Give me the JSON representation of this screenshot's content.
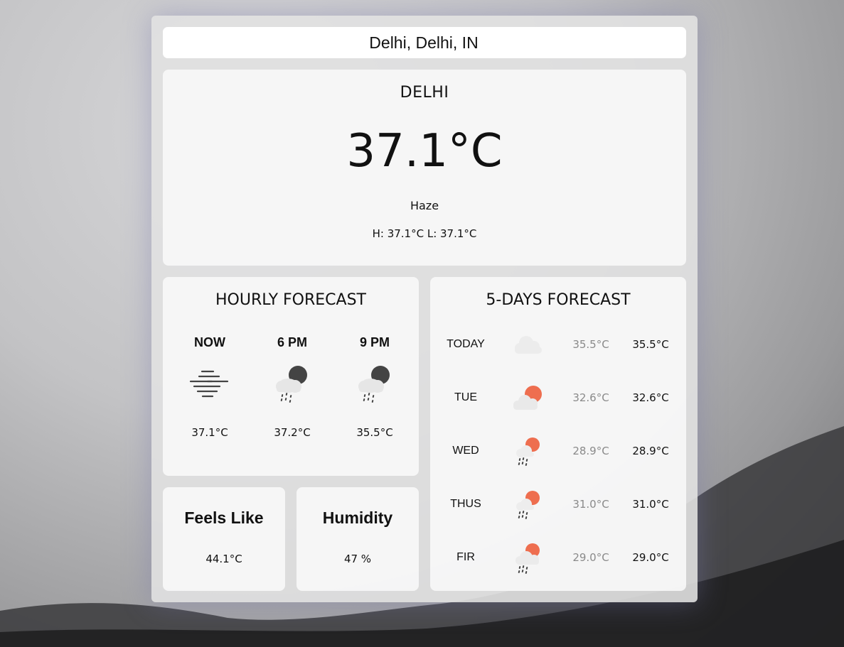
{
  "search": {
    "value": "Delhi, Delhi, IN"
  },
  "current": {
    "city": "DELHI",
    "temp": "37.1°C",
    "condition": "Haze",
    "hilo": "H: 37.1°C L: 37.1°C"
  },
  "hourly": {
    "title": "HOURLY FORECAST",
    "items": [
      {
        "label": "NOW",
        "icon": "haze-icon",
        "temp": "37.1°C"
      },
      {
        "label": "6 PM",
        "icon": "night-rain-icon",
        "temp": "37.2°C"
      },
      {
        "label": "9 PM",
        "icon": "night-rain-icon",
        "temp": "35.5°C"
      }
    ]
  },
  "feels_like": {
    "title": "Feels Like",
    "value": "44.1°C"
  },
  "humidity": {
    "title": "Humidity",
    "value": "47 %"
  },
  "daily": {
    "title": "5-DAYS FORECAST",
    "items": [
      {
        "day": "TODAY",
        "icon": "cloud-icon",
        "min": "35.5°C",
        "max": "35.5°C"
      },
      {
        "day": "TUE",
        "icon": "partly-cloudy-day-icon",
        "min": "32.6°C",
        "max": "32.6°C"
      },
      {
        "day": "WED",
        "icon": "day-rain-icon",
        "min": "28.9°C",
        "max": "28.9°C"
      },
      {
        "day": "THUS",
        "icon": "day-rain-icon",
        "min": "31.0°C",
        "max": "31.0°C"
      },
      {
        "day": "FIR",
        "icon": "day-rain-cloud-icon",
        "min": "29.0°C",
        "max": "29.0°C"
      }
    ]
  },
  "colors": {
    "sun": "#ee6e4f",
    "moon": "#444444",
    "cloud": "#e6e6e6",
    "muted": "#8a8a8a"
  }
}
